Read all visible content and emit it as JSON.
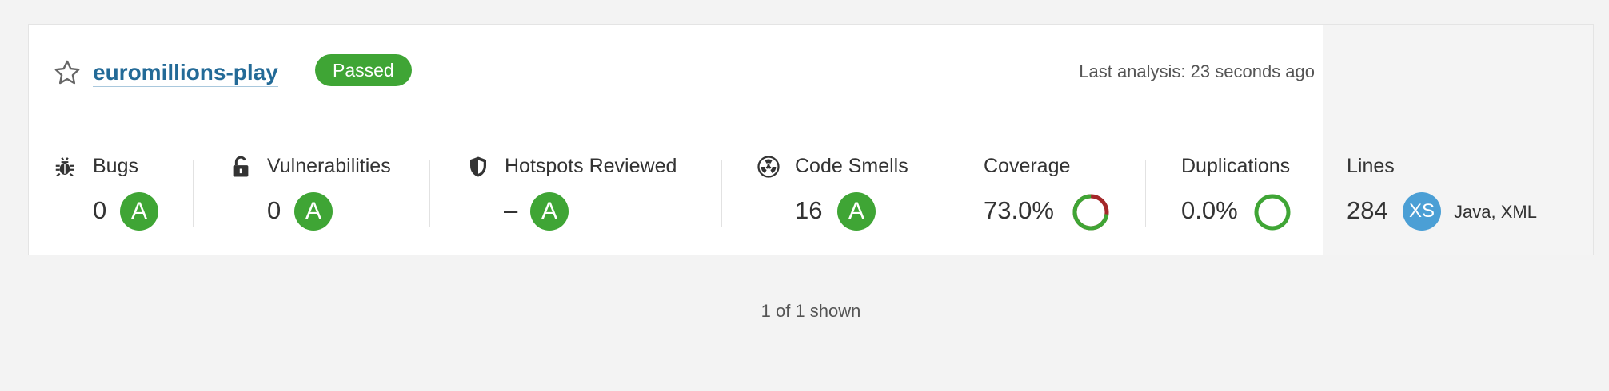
{
  "project": {
    "name": "euromillions-play",
    "quality_gate": "Passed",
    "last_analysis": "Last analysis: 23 seconds ago"
  },
  "metrics": {
    "bugs": {
      "label": "Bugs",
      "value": "0",
      "rating": "A"
    },
    "vulnerabilities": {
      "label": "Vulnerabilities",
      "value": "0",
      "rating": "A"
    },
    "hotspots": {
      "label": "Hotspots Reviewed",
      "value": "–",
      "rating": "A"
    },
    "code_smells": {
      "label": "Code Smells",
      "value": "16",
      "rating": "A"
    },
    "coverage": {
      "label": "Coverage",
      "value": "73.0%",
      "percent": 73.0
    },
    "duplications": {
      "label": "Duplications",
      "value": "0.0%",
      "percent": 0.0
    },
    "lines": {
      "label": "Lines",
      "value": "284",
      "size": "XS",
      "languages": "Java, XML"
    }
  },
  "footer": {
    "shown": "1 of 1 shown"
  },
  "icons": {
    "favorite": "star-icon",
    "bugs": "bug-icon",
    "vulnerabilities": "lock-icon",
    "hotspots": "shield-icon",
    "code_smells": "radiation-icon"
  },
  "colors": {
    "passed": "#3fa535",
    "rating_a": "#3fa535",
    "link": "#236a97",
    "coverage_covered": "#3fa535",
    "coverage_uncovered": "#a4282a",
    "size_badge": "#4b9fd5"
  }
}
